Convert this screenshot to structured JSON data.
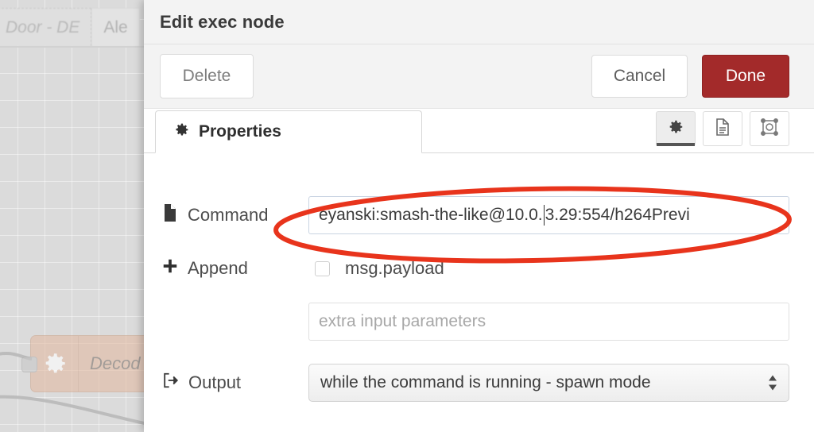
{
  "canvas": {
    "flow_tabs": [
      {
        "label": "Door - DE",
        "active": false
      },
      {
        "label": "Ale",
        "active": true
      }
    ],
    "node": {
      "label": "Decod",
      "icon": "gear-icon"
    }
  },
  "dialog": {
    "title": "Edit exec node",
    "buttons": {
      "delete": "Delete",
      "cancel": "Cancel",
      "done": "Done"
    },
    "tabs": {
      "properties": {
        "label": "Properties",
        "icon": "gear-icon",
        "active": true
      },
      "icon_tabs": [
        {
          "name": "gear-icon",
          "active": true
        },
        {
          "name": "description-icon",
          "active": false
        },
        {
          "name": "appearance-icon",
          "active": false
        }
      ]
    },
    "form": {
      "command": {
        "label": "Command",
        "icon": "file-icon",
        "value_before_caret": "eyanski:smash-the-like@10.0.",
        "value_after_caret": "3.29:554/h264Previ"
      },
      "append": {
        "label": "Append",
        "icon": "plus-icon",
        "checkbox_label": "msg.payload",
        "checked": false,
        "extra_placeholder": "extra input parameters",
        "extra_value": ""
      },
      "output": {
        "label": "Output",
        "icon": "sign-out-icon",
        "selected": "while the command is running - spawn mode"
      }
    }
  },
  "annotation": {
    "type": "ellipse",
    "color": "#e8341c"
  }
}
